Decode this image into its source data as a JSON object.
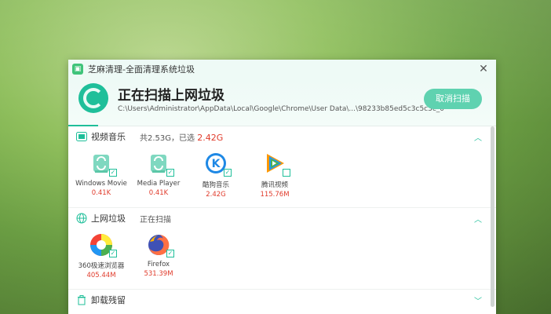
{
  "window": {
    "title": "芝麻清理-全面清理系统垃圾",
    "close_glyph": "✕"
  },
  "header": {
    "scan_title": "正在扫描上网垃圾",
    "scan_path": "C:\\Users\\Administrator\\AppData\\Local\\Google\\Chrome\\User  Data\\...\\98233b85ed5c3c5c3c_0",
    "cancel_label": "取消扫描"
  },
  "sections": [
    {
      "label": "视频音乐",
      "status_prefix": "共2.53G，已选 ",
      "status_highlight": "2.42G",
      "toggle": "︿",
      "items": [
        {
          "name": "Windows Movie",
          "size": "0.41K",
          "checked": true,
          "icon": "movie-icon"
        },
        {
          "name": "Media Player",
          "size": "0.41K",
          "checked": true,
          "icon": "media-player-icon"
        },
        {
          "name": "酷狗音乐",
          "size": "2.42G",
          "checked": true,
          "icon": "kugou-icon"
        },
        {
          "name": "腾讯视频",
          "size": "115.76M",
          "checked": false,
          "icon": "tencent-video-icon"
        }
      ]
    },
    {
      "label": "上网垃圾",
      "status_prefix": "正在扫描",
      "status_highlight": "",
      "toggle": "︿",
      "items": [
        {
          "name": "360极速浏览器",
          "size": "405.44M",
          "checked": true,
          "icon": "360-browser-icon"
        },
        {
          "name": "Firefox",
          "size": "531.39M",
          "checked": true,
          "icon": "firefox-icon"
        }
      ]
    },
    {
      "label": "卸载残留",
      "status_prefix": "",
      "status_highlight": "",
      "toggle": "﹀"
    }
  ],
  "colors": {
    "accent": "#1fbf9a",
    "highlight": "#e03a2a"
  }
}
